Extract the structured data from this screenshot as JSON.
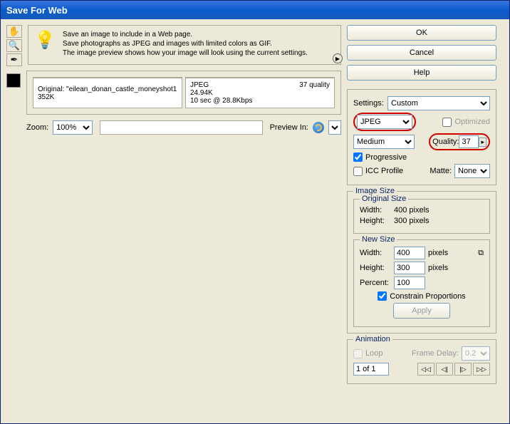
{
  "title": "Save For Web",
  "hint": {
    "line1": "Save an image to include in a Web page.",
    "line2": "Save photographs as JPEG and images with limited colors as GIF.",
    "line3": "The image preview shows how your image will look using the current settings."
  },
  "buttons": {
    "ok": "OK",
    "cancel": "Cancel",
    "help": "Help",
    "apply": "Apply"
  },
  "settings": {
    "label": "Settings:",
    "preset": "Custom",
    "format": "JPEG",
    "quality_preset": "Medium",
    "optimized_label": "Optimized",
    "quality_label": "Quality:",
    "quality_value": "37",
    "progressive_label": "Progressive",
    "progressive_checked": true,
    "icc_label": "ICC Profile",
    "icc_checked": false,
    "matte_label": "Matte:",
    "matte_value": "None"
  },
  "image_size": {
    "legend": "Image Size",
    "orig_legend": "Original Size",
    "width_label": "Width:",
    "height_label": "Height:",
    "orig_width": "400 pixels",
    "orig_height": "300 pixels",
    "new_legend": "New Size",
    "new_width": "400",
    "new_height": "300",
    "pixels": "pixels",
    "percent_label": "Percent:",
    "percent": "100",
    "constrain": "Constrain Proportions"
  },
  "animation": {
    "legend": "Animation",
    "loop": "Loop",
    "frame_delay_label": "Frame Delay:",
    "frame_delay": "0.2",
    "frames": "1 of 1"
  },
  "preview": {
    "original_label": "Original:",
    "original_name": "\"eilean_donan_castle_moneyshot1",
    "original_size": "352K",
    "opt_format": "JPEG",
    "opt_size": "24.94K",
    "opt_time": "10 sec @ 28.8Kbps",
    "opt_quality": "37 quality"
  },
  "zoom": {
    "label": "Zoom:",
    "value": "100%",
    "preview_in": "Preview In:"
  }
}
